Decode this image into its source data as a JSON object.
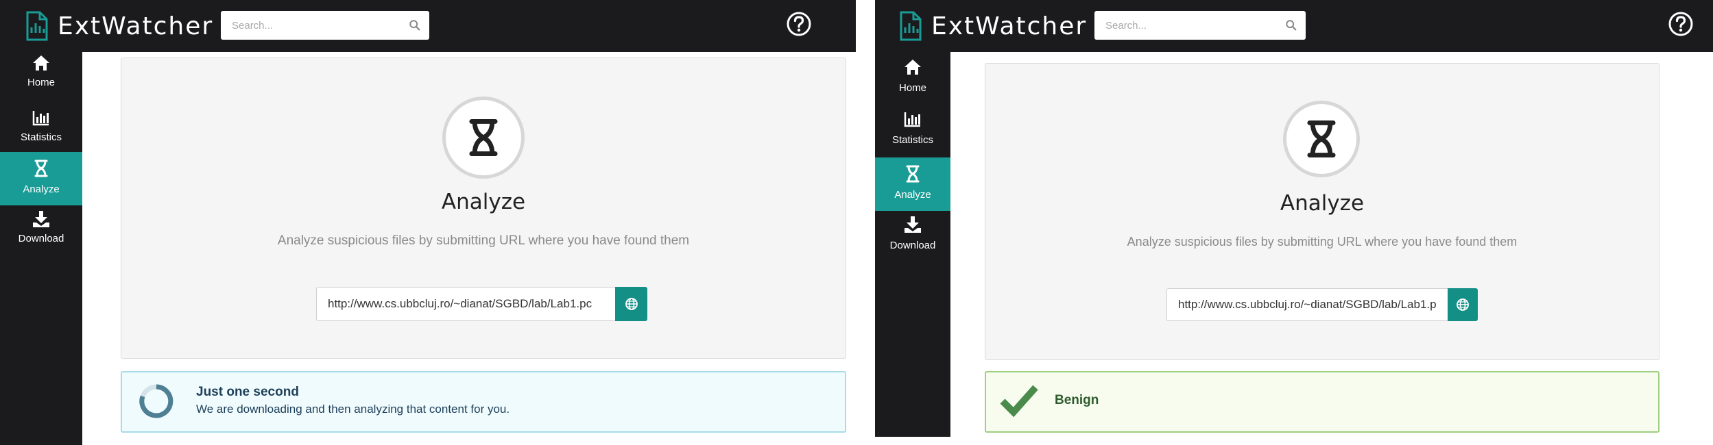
{
  "colors": {
    "brand": "#1a9c96",
    "button": "#148f86",
    "dark": "#1b1b1d"
  },
  "app": {
    "name": "ExtWatcher",
    "search_placeholder": "Search..."
  },
  "sidebar": {
    "items": [
      {
        "label": "Home",
        "icon": "home-icon"
      },
      {
        "label": "Statistics",
        "icon": "bar-chart-icon"
      },
      {
        "label": "Analyze",
        "icon": "dna-icon",
        "active": true
      },
      {
        "label": "Download",
        "icon": "download-icon"
      }
    ]
  },
  "analyze": {
    "title": "Analyze",
    "subtitle": "Analyze suspicious files by submitting URL where you have found them",
    "url_value": "http://www.cs.ubbcluj.ro/~dianat/SGBD/lab/Lab1.pc"
  },
  "status_loading": {
    "title": "Just one second",
    "body": "We are downloading and then analyzing that content for you."
  },
  "status_result": {
    "title": "Benign"
  }
}
